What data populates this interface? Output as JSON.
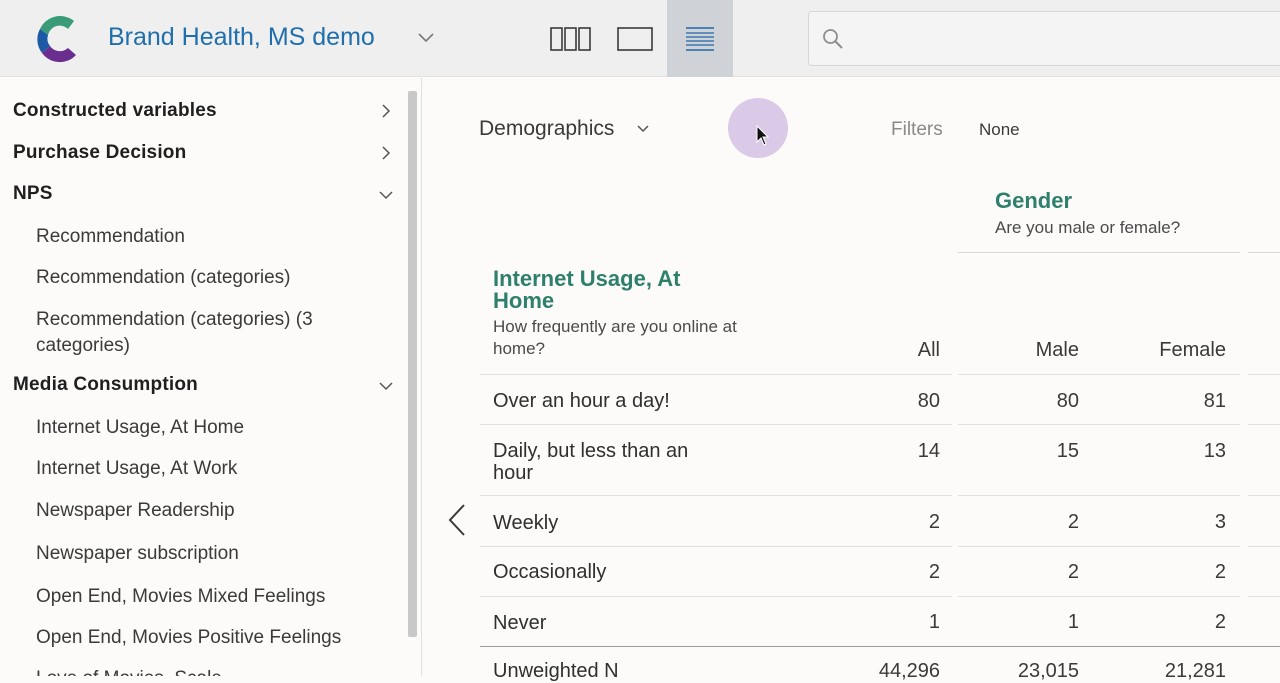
{
  "header": {
    "dataset_title": "Brand Health, MS demo",
    "view_buttons": [
      {
        "icon": "columns-view-icon",
        "active": false
      },
      {
        "icon": "single-view-icon",
        "active": false
      },
      {
        "icon": "table-view-icon",
        "active": true
      }
    ],
    "search": {
      "placeholder": "",
      "value": ""
    },
    "colors": {
      "brand": "#1f6fad",
      "active_view_bg": "#cfd3d8"
    }
  },
  "sidebar": {
    "categories": [
      {
        "label": "Constructed variables",
        "expanded": false
      },
      {
        "label": "Purchase Decision",
        "expanded": false
      },
      {
        "label": "NPS",
        "expanded": true,
        "items": [
          "Recommendation",
          "Recommendation (categories)",
          "Recommendation (categories) (3 categories)"
        ]
      },
      {
        "label": "Media Consumption",
        "expanded": true,
        "items": [
          "Internet Usage, At Home",
          "Internet Usage, At Work",
          "Newspaper Readership",
          "Newspaper subscription",
          "Open End, Movies Mixed Feelings",
          "Open End, Movies Positive Feelings",
          "Love of Movies, Scale"
        ]
      }
    ]
  },
  "main": {
    "multitable_dropdown": "Demographics",
    "filters_label": "Filters",
    "filters_value": "None",
    "column_variable": {
      "title": "Gender",
      "question": "Are you male or female?"
    },
    "row_variable": {
      "title": "Internet Usage, At Home",
      "question": "How frequently are you online at home?"
    },
    "columns": [
      "All",
      "Male",
      "Female"
    ],
    "rows": [
      {
        "label": "Over an hour a day!",
        "values": [
          "80",
          "80",
          "81"
        ]
      },
      {
        "label": "Daily, but less than an hour",
        "values": [
          "14",
          "15",
          "13"
        ]
      },
      {
        "label": "Weekly",
        "values": [
          "2",
          "2",
          "3"
        ]
      },
      {
        "label": "Occasionally",
        "values": [
          "2",
          "2",
          "2"
        ]
      },
      {
        "label": "Never",
        "values": [
          "1",
          "1",
          "2"
        ]
      }
    ],
    "footer_row": {
      "label": "Unweighted N",
      "values": [
        "44,296",
        "23,015",
        "21,281"
      ]
    },
    "colors": {
      "variable_title": "#2e7f6b"
    }
  }
}
